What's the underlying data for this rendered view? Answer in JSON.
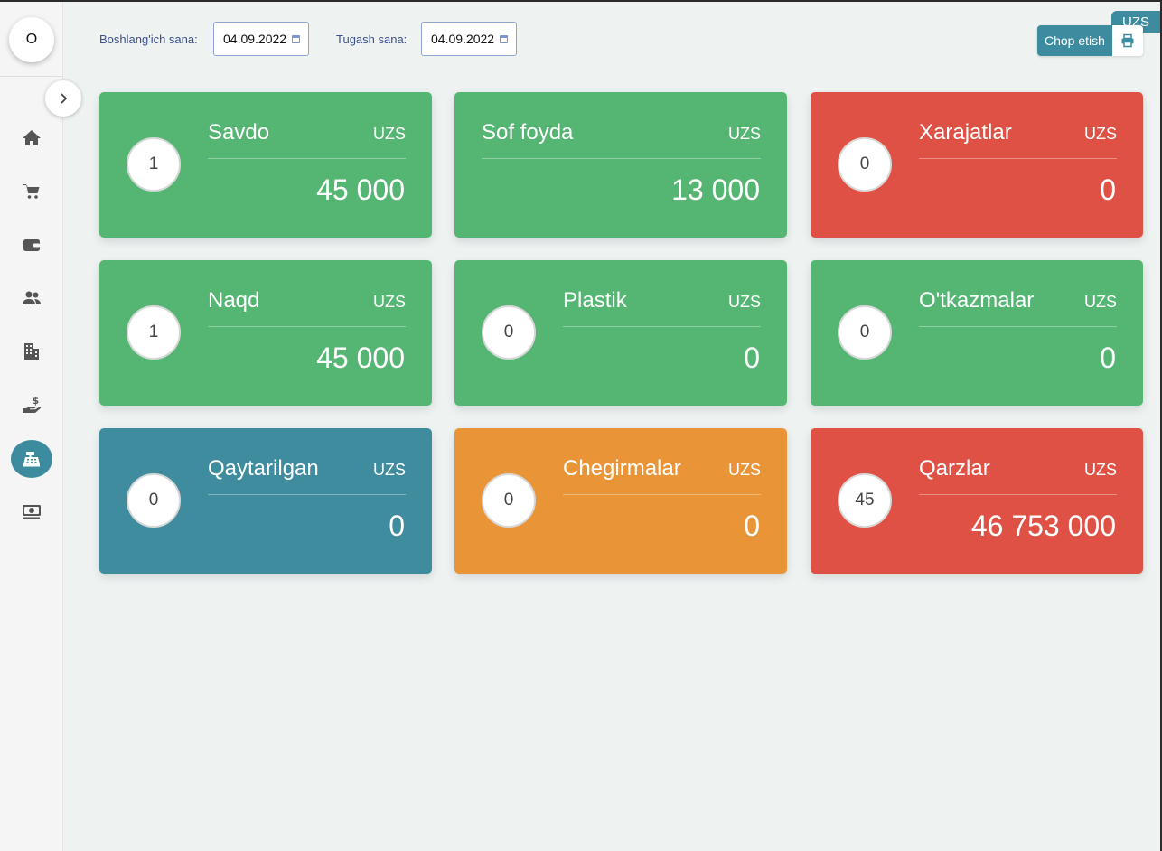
{
  "sidebar": {
    "avatar_initial": "O",
    "items": [
      {
        "icon": "home-icon"
      },
      {
        "icon": "cart-icon"
      },
      {
        "icon": "wallet-icon"
      },
      {
        "icon": "users-icon"
      },
      {
        "icon": "building-icon"
      },
      {
        "icon": "hand-money-icon"
      },
      {
        "icon": "cash-register-icon",
        "active": true
      },
      {
        "icon": "money-bill-icon"
      }
    ]
  },
  "filters": {
    "start_label": "Boshlang'ich sana:",
    "start_value": "04.09.2022",
    "end_label": "Tugash sana:",
    "end_value": "04.09.2022"
  },
  "header": {
    "currency_badge": "UZS",
    "print_label": "Chop etish"
  },
  "cards": [
    {
      "title": "Savdo",
      "currency": "UZS",
      "count": "1",
      "value": "45 000",
      "color": "#55b673"
    },
    {
      "title": "Sof foyda",
      "currency": "UZS",
      "count": "",
      "value": "13 000",
      "color": "#55b673"
    },
    {
      "title": "Xarajatlar",
      "currency": "UZS",
      "count": "0",
      "value": "0",
      "color": "#df5144"
    },
    {
      "title": "Naqd",
      "currency": "UZS",
      "count": "1",
      "value": "45 000",
      "color": "#55b673"
    },
    {
      "title": "Plastik",
      "currency": "UZS",
      "count": "0",
      "value": "0",
      "color": "#55b673"
    },
    {
      "title": "O'tkazmalar",
      "currency": "UZS",
      "count": "0",
      "value": "0",
      "color": "#55b673"
    },
    {
      "title": "Qaytarilgan",
      "currency": "UZS",
      "count": "0",
      "value": "0",
      "color": "#3f8c9f"
    },
    {
      "title": "Chegirmalar",
      "currency": "UZS",
      "count": "0",
      "value": "0",
      "color": "#e99437"
    },
    {
      "title": "Qarzlar",
      "currency": "UZS",
      "count": "45",
      "value": "46 753 000",
      "color": "#df5144"
    }
  ]
}
